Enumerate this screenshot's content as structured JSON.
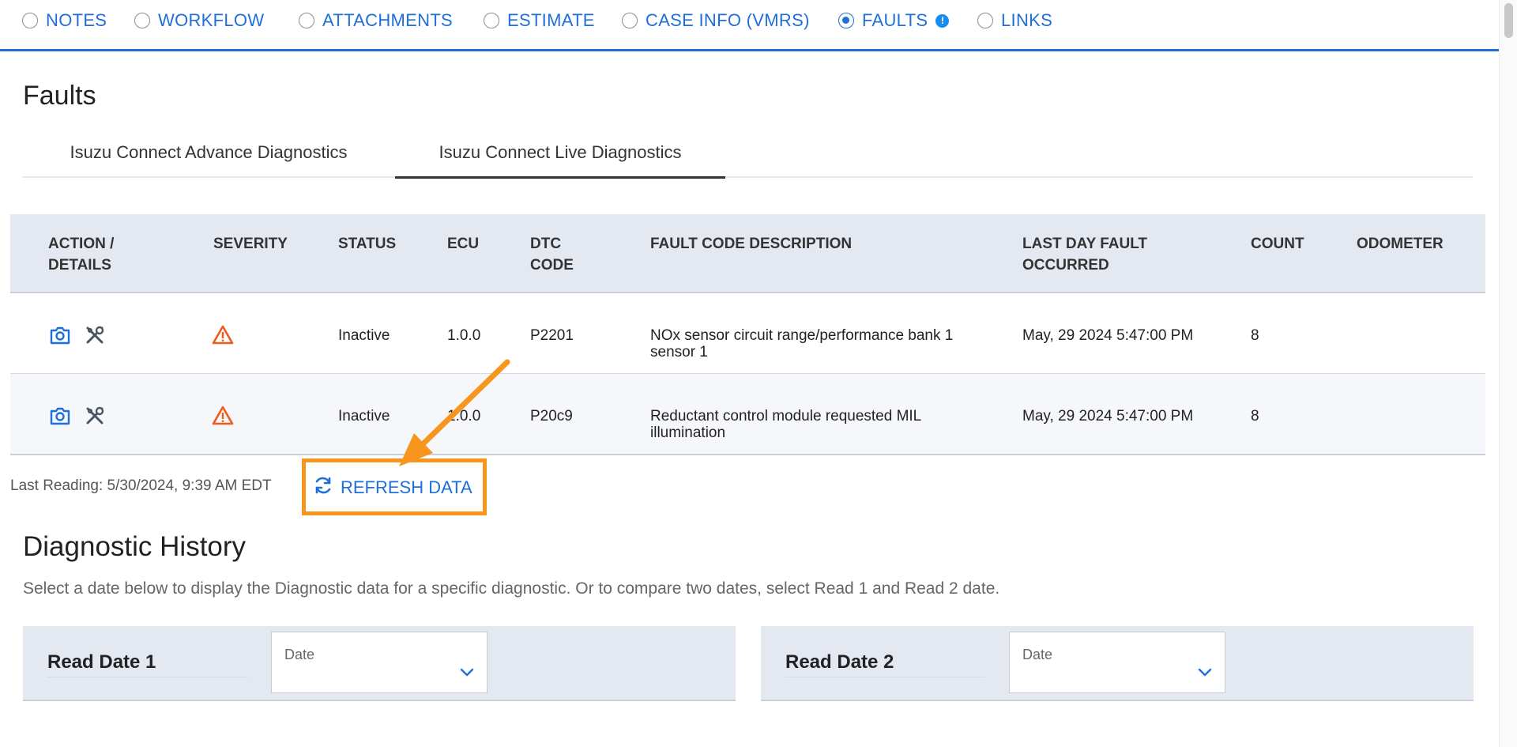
{
  "nav": {
    "items": [
      {
        "label": "NOTES",
        "checked": false
      },
      {
        "label": "WORKFLOW",
        "checked": false
      },
      {
        "label": "ATTACHMENTS",
        "checked": false
      },
      {
        "label": "ESTIMATE",
        "checked": false
      },
      {
        "label": "CASE INFO (VMRS)",
        "checked": false
      },
      {
        "label": "FAULTS",
        "checked": true,
        "badge": "!"
      },
      {
        "label": "LINKS",
        "checked": false
      }
    ]
  },
  "page": {
    "title": "Faults",
    "tabs": [
      {
        "label": "Isuzu Connect Advance Diagnostics",
        "active": false
      },
      {
        "label": "Isuzu Connect Live Diagnostics",
        "active": true
      }
    ]
  },
  "table": {
    "headers": {
      "action": "ACTION / DETAILS",
      "severity": "SEVERITY",
      "status": "STATUS",
      "ecu": "ECU",
      "dtc": "DTC CODE",
      "description": "FAULT CODE DESCRIPTION",
      "last_day": "LAST DAY FAULT OCCURRED",
      "count": "COUNT",
      "odometer": "ODOMETER"
    },
    "rows": [
      {
        "status": "Inactive",
        "ecu": "1.0.0",
        "dtc": "P2201",
        "description": "NOx sensor circuit range/performance bank 1 sensor 1",
        "last_day": "May, 29 2024 5:47:00 PM",
        "count": "8",
        "odometer": ""
      },
      {
        "status": "Inactive",
        "ecu": "1.0.0",
        "dtc": "P20c9",
        "description": "Reductant control module requested MIL illumination",
        "last_day": "May, 29 2024 5:47:00 PM",
        "count": "8",
        "odometer": ""
      }
    ]
  },
  "refresh": {
    "last_reading": "Last Reading: 5/30/2024, 9:39 AM EDT",
    "button_label": "REFRESH DATA"
  },
  "history": {
    "title": "Diagnostic History",
    "description": "Select a date below to display the Diagnostic data for a specific diagnostic. Or to compare two dates, select Read 1 and Read 2 date.",
    "read1": {
      "label": "Read Date 1",
      "placeholder": "Date"
    },
    "read2": {
      "label": "Read Date 2",
      "placeholder": "Date"
    }
  },
  "colors": {
    "accent": "#1e6fd9",
    "warning": "#f05a1a",
    "highlight": "#f7951d",
    "header_bg": "#e3e8f1"
  },
  "icons": {
    "camera": "camera-icon",
    "tools": "tools-icon",
    "warning": "warning-triangle-icon",
    "refresh": "refresh-icon",
    "chevron": "chevron-down-icon",
    "annotation": "annotation-arrow"
  }
}
